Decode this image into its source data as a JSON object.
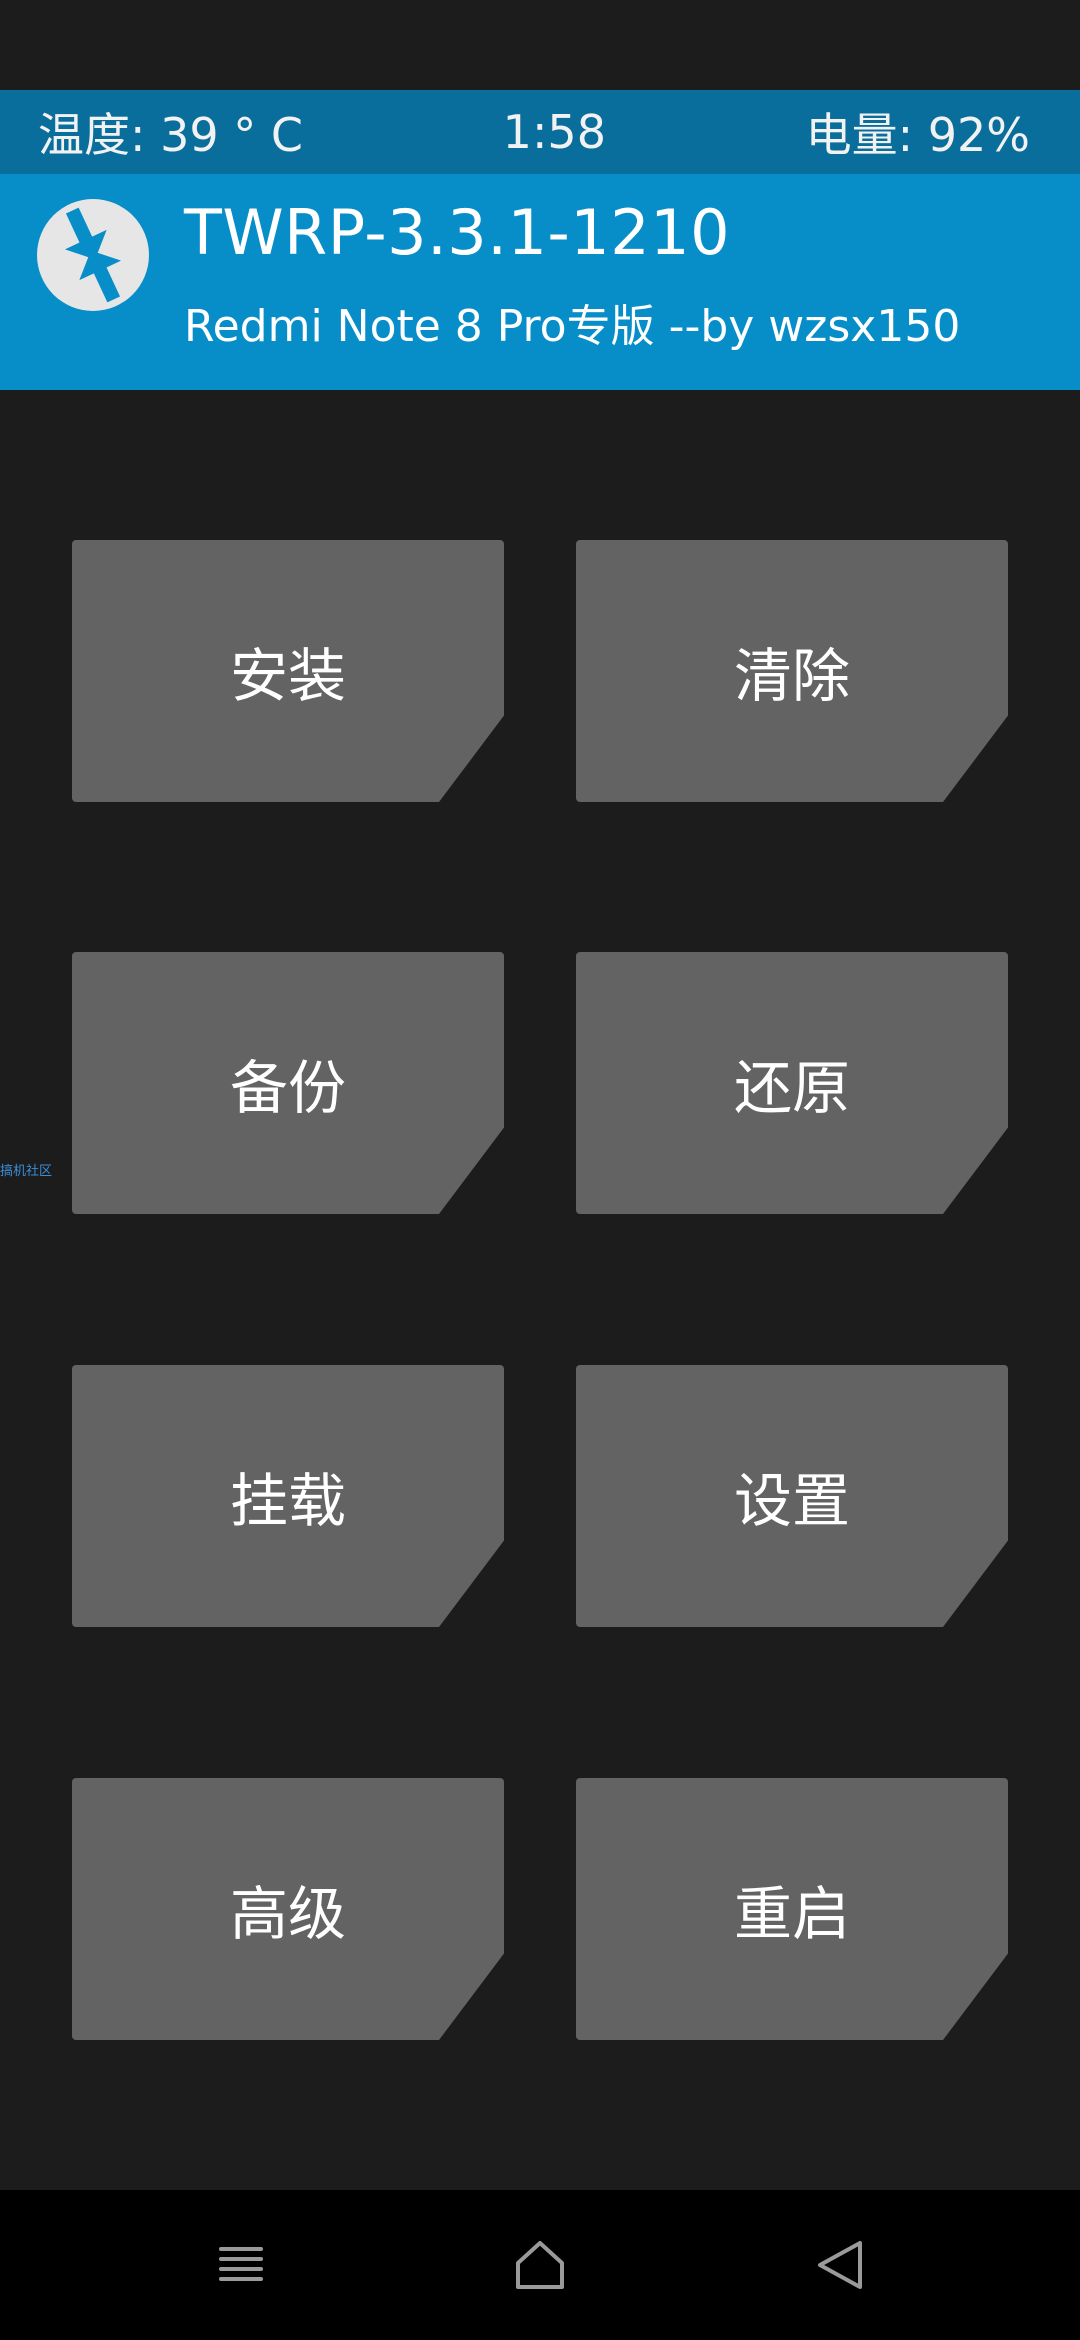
{
  "status_bar": {
    "temperature": "温度: 39 ° C",
    "time": "1:58",
    "battery": "电量: 92%"
  },
  "header": {
    "logo_icon": "twrp-logo-icon",
    "title": "TWRP-3.3.1-1210",
    "subtitle": "Redmi Note 8 Pro专版  --by wzsx150"
  },
  "menu": {
    "buttons": [
      {
        "label": "安装"
      },
      {
        "label": "清除"
      },
      {
        "label": "备份"
      },
      {
        "label": "还原"
      },
      {
        "label": "挂载"
      },
      {
        "label": "设置"
      },
      {
        "label": "高级"
      },
      {
        "label": "重启"
      }
    ]
  },
  "watermark": {
    "text": "搞机社区"
  },
  "nav_bar": {
    "icons": [
      "menu-icon",
      "home-icon",
      "back-icon"
    ]
  },
  "colors": {
    "background": "#1c1c1c",
    "status_bar": "#0a6e9c",
    "header": "#078ec9",
    "tile": "#636363",
    "nav_bar": "#000000"
  }
}
